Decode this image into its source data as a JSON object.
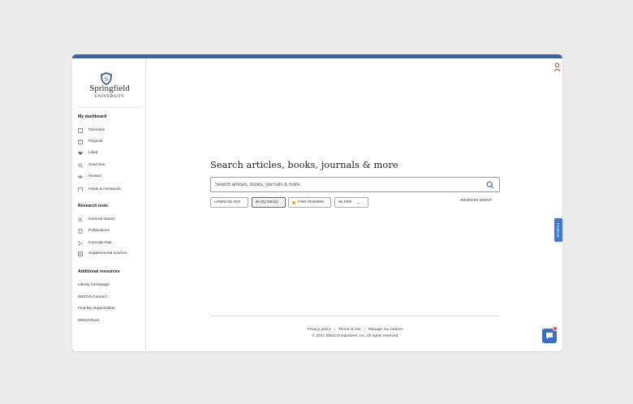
{
  "logo": {
    "name": "Springfield",
    "sub": "UNIVERSITY"
  },
  "sidebar": {
    "dashboard_heading": "My dashboard",
    "dashboard_items": [
      {
        "label": "Overview",
        "icon": "overview-icon"
      },
      {
        "label": "Projects",
        "icon": "projects-icon"
      },
      {
        "label": "Liked",
        "icon": "heart-icon"
      },
      {
        "label": "Searches",
        "icon": "search-icon"
      },
      {
        "label": "Viewed",
        "icon": "eye-icon"
      },
      {
        "label": "Holds & checkouts",
        "icon": "holds-icon"
      }
    ],
    "tools_heading": "Research tools",
    "tools_items": [
      {
        "label": "General search",
        "icon": "search-icon"
      },
      {
        "label": "Publications",
        "icon": "publication-icon"
      },
      {
        "label": "Concept map",
        "icon": "concept-map-icon"
      },
      {
        "label": "Supplemental sources",
        "icon": "supplemental-icon"
      }
    ],
    "resources_heading": "Additional resources",
    "resources_items": [
      {
        "label": "Library homepage"
      },
      {
        "label": "EBSCO Connect"
      },
      {
        "label": "Find My Organization"
      },
      {
        "label": "EBSCOhost"
      }
    ]
  },
  "main": {
    "title": "Search articles, books, journals & more",
    "search_placeholder": "Search articles, books, journals & more.",
    "filters": [
      {
        "label": "Linked full text"
      },
      {
        "label": "At my library"
      },
      {
        "label": "Peer reviewed"
      },
      {
        "label": "All time"
      }
    ],
    "advanced_search": "Advanced search"
  },
  "footer": {
    "privacy": "Privacy policy",
    "terms": "Terms of use",
    "cookies": "Manage my cookies",
    "separator": "|",
    "copyright": "© 2021 EBSCO Industries, Inc. All rights reserved"
  },
  "feedback_label": "Feedback",
  "colors": {
    "accent": "#3b63ad",
    "peer_dot": "#f4a51c",
    "chat": "#3b6fc6",
    "badge": "#e24b4b"
  }
}
